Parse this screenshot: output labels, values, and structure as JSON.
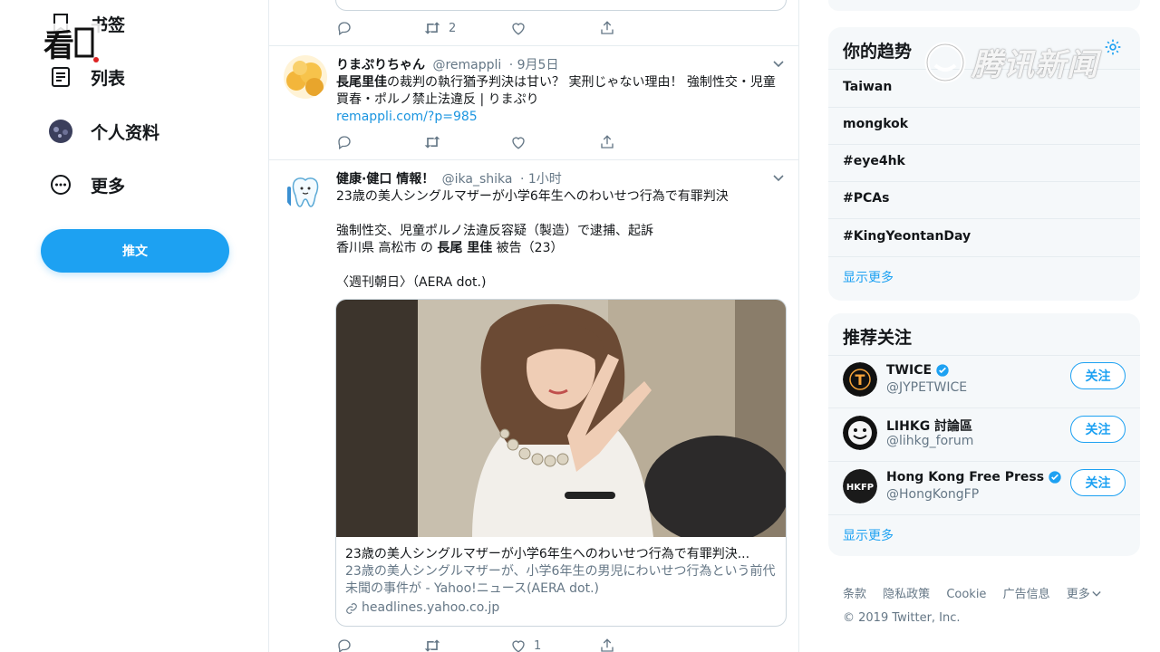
{
  "nav": {
    "bookmarks": "书签",
    "lists": "列表",
    "profile": "个人资料",
    "more": "更多",
    "tweet_button": "推文"
  },
  "tweets": [
    {
      "retweet_count": "2"
    },
    {
      "name": "りまぷりちゃん",
      "handle": "@remappli",
      "time": "· 9月5日",
      "bold_lead": "長尾里佳",
      "text_rest": "の裁判の執行猶予判決は甘い？ 実刑じゃない理由！ 強制性交・児童買春・ポルノ禁止法違反 | りまぷり",
      "link": "remappli.com/?p=985"
    },
    {
      "name": "健康·健口 情報！",
      "handle": "@ika_shika",
      "time": "· 1小时",
      "line1": "23歳の美人シングルマザーが小学6年生へのわいせつ行為で有罪判決",
      "line2": "強制性交、児童ポルノ法違反容疑（製造）で逮捕、起訴",
      "line3_a": "香川県 高松市 の ",
      "line3_b": "長尾 里佳",
      "line3_c": " 被告（23）",
      "line4": "〈週刊朝日〉（AERA dot.)",
      "card_title": "23歳の美人シングルマザーが小学6年生へのわいせつ行為で有罪判決...",
      "card_desc": "23歳の美人シングルマザーが、小学6年生の男児にわいせつ行為という前代未聞の事件が - Yahoo!ニュース(AERA dot.)",
      "card_url": "headlines.yahoo.co.jp",
      "like_count": "1"
    }
  ],
  "trends": {
    "title": "你的趋势",
    "items": [
      "Taiwan",
      "mongkok",
      "#eye4hk",
      "#PCAs",
      "#KingYeontanDay"
    ],
    "show_more": "显示更多"
  },
  "who_to_follow": {
    "title": "推荐关注",
    "accounts": [
      {
        "name": "TWICE",
        "handle": "@JYPETWICE",
        "verified": true
      },
      {
        "name": "LIHKG 討論區",
        "handle": "@lihkg_forum",
        "verified": false
      },
      {
        "name": "Hong Kong Free Press",
        "handle": "@HongKongFP",
        "verified": true
      }
    ],
    "follow_label": "关注",
    "show_more": "显示更多"
  },
  "footer": {
    "links": [
      "条款",
      "隐私政策",
      "Cookie",
      "广告信息",
      "更多"
    ],
    "copyright": "© 2019 Twitter, Inc."
  },
  "watermark": {
    "left_text": "看",
    "right_text": "腾讯新闻"
  },
  "colors": {
    "accent": "#1da1f2",
    "link": "#1b95e0",
    "muted": "#657786",
    "panel_bg": "#f5f8fa"
  }
}
